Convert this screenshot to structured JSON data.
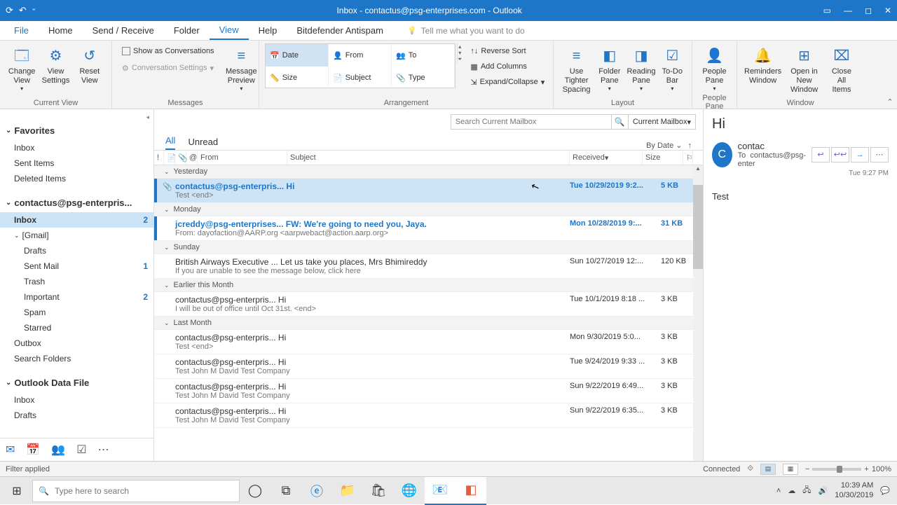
{
  "title": "Inbox - contactus@psg-enterprises.com - Outlook",
  "menu": {
    "file": "File",
    "home": "Home",
    "sendreceive": "Send / Receive",
    "folder": "Folder",
    "view": "View",
    "help": "Help",
    "bitdefender": "Bitdefender Antispam",
    "tell": "Tell me what you want to do"
  },
  "ribbon": {
    "currentview": {
      "change": "Change View",
      "settings": "View Settings",
      "reset": "Reset View",
      "label": "Current View"
    },
    "messages": {
      "conv": "Show as Conversations",
      "convset": "Conversation Settings",
      "preview": "Message Preview",
      "label": "Messages"
    },
    "arrange": {
      "date": "Date",
      "from": "From",
      "to": "To",
      "size": "Size",
      "subject": "Subject",
      "type": "Type",
      "rev": "Reverse Sort",
      "addcols": "Add Columns",
      "expand": "Expand/Collapse",
      "label": "Arrangement"
    },
    "layout": {
      "tight": "Use Tighter Spacing",
      "folder": "Folder Pane",
      "reading": "Reading Pane",
      "todo": "To-Do Bar",
      "label": "Layout"
    },
    "people": {
      "btn": "People Pane",
      "label": "People Pane"
    },
    "window": {
      "rem": "Reminders Window",
      "open": "Open in New Window",
      "close": "Close All Items",
      "label": "Window"
    }
  },
  "nav": {
    "favorites": "Favorites",
    "fav_inbox": "Inbox",
    "fav_sent": "Sent Items",
    "fav_del": "Deleted Items",
    "acct": "contactus@psg-enterpris...",
    "inbox": "Inbox",
    "inbox_cnt": "2",
    "gmail": "[Gmail]",
    "drafts": "Drafts",
    "sentmail": "Sent Mail",
    "sentmail_cnt": "1",
    "trash": "Trash",
    "important": "Important",
    "important_cnt": "2",
    "spam": "Spam",
    "starred": "Starred",
    "outbox": "Outbox",
    "searchf": "Search Folders",
    "datafile": "Outlook Data File",
    "df_inbox": "Inbox",
    "df_drafts": "Drafts"
  },
  "search": {
    "placeholder": "Search Current Mailbox",
    "scope": "Current Mailbox"
  },
  "tabs": {
    "all": "All",
    "unread": "Unread",
    "sort": "By Date"
  },
  "cols": {
    "from": "From",
    "subject": "Subject",
    "received": "Received",
    "size": "Size"
  },
  "groups": {
    "g1": "Yesterday",
    "g2": "Monday",
    "g3": "Sunday",
    "g4": "Earlier this Month",
    "g5": "Last Month"
  },
  "messages_list": {
    "m1": {
      "from": "contactus@psg-enterpris...  Hi",
      "prev": "Test <end>",
      "date": "Tue 10/29/2019 9:2...",
      "size": "5 KB"
    },
    "m2": {
      "from": "jcreddy@psg-enterprises...  FW: We're going to need you, Jaya.",
      "prev": "From: dayofaction@AARP.org <aarpwebact@action.aarp.org>",
      "date": "Mon 10/28/2019 9:...",
      "size": "31 KB"
    },
    "m3": {
      "from": "British Airways Executive ...  Let us take you places, Mrs Bhimireddy",
      "prev": "If you are unable to see the message below, click here",
      "date": "Sun 10/27/2019 12:...",
      "size": "120 KB"
    },
    "m4": {
      "from": "contactus@psg-enterpris...  Hi",
      "prev": "I will be out of office until Oct 31st. <end>",
      "date": "Tue 10/1/2019 8:18 ...",
      "size": "3 KB"
    },
    "m5": {
      "from": "contactus@psg-enterpris...  Hi",
      "prev": "Test <end>",
      "date": "Mon 9/30/2019 5:0...",
      "size": "3 KB"
    },
    "m6": {
      "from": "contactus@psg-enterpris...  Hi",
      "prev": "Test  John M David  Test Company",
      "date": "Tue 9/24/2019 9:33 ...",
      "size": "3 KB"
    },
    "m7": {
      "from": "contactus@psg-enterpris...  Hi",
      "prev": "Test  John M David  Test Company",
      "date": "Sun 9/22/2019 6:49...",
      "size": "3 KB"
    },
    "m8": {
      "from": "contactus@psg-enterpris...  Hi",
      "prev": "Test  John M David  Test Company",
      "date": "Sun 9/22/2019 6:35...",
      "size": "3 KB"
    }
  },
  "reading": {
    "subject": "Hi",
    "avatar": "C",
    "name": "contac",
    "to": "To",
    "recipient": "contactus@psg-enter",
    "time": "Tue 9:27 PM",
    "body": "Test"
  },
  "status": {
    "filter": "Filter applied",
    "connected": "Connected",
    "zoom": "100%"
  },
  "taskbar": {
    "search": "Type here to search",
    "time": "10:39 AM",
    "date": "10/30/2019"
  }
}
